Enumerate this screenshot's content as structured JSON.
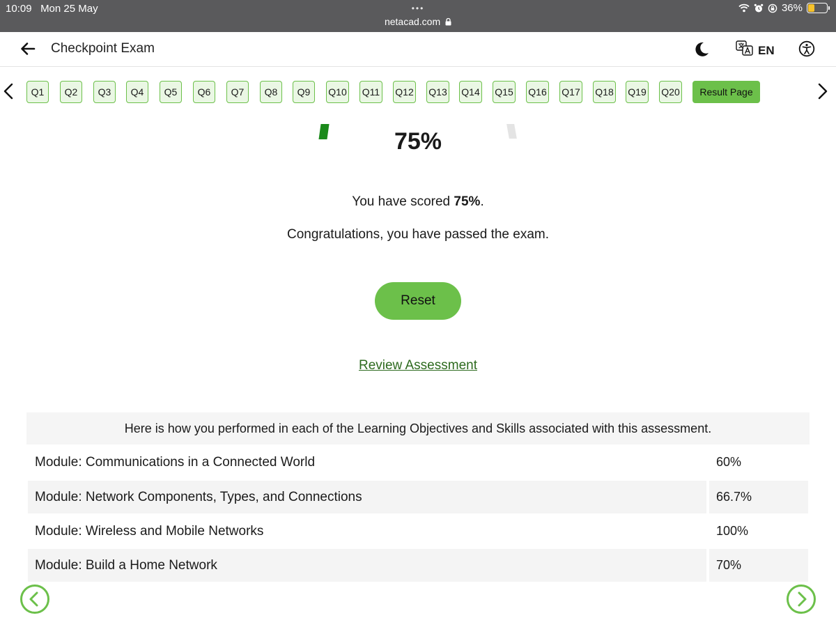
{
  "status": {
    "time": "10:09",
    "date": "Mon 25 May",
    "battery": "36%",
    "battery_level": 0.36,
    "url": "netacad.com",
    "dots": "•••"
  },
  "header": {
    "title": "Checkpoint Exam",
    "language": "EN"
  },
  "nav": {
    "questions": [
      "Q1",
      "Q2",
      "Q3",
      "Q4",
      "Q5",
      "Q6",
      "Q7",
      "Q8",
      "Q9",
      "Q10",
      "Q11",
      "Q12",
      "Q13",
      "Q14",
      "Q15",
      "Q16",
      "Q17",
      "Q18",
      "Q19",
      "Q20"
    ],
    "result_label": "Result Page"
  },
  "result": {
    "score": "75%",
    "score_value": 75,
    "scored_prefix": "You have scored ",
    "scored_value": "75%",
    "scored_suffix": ".",
    "message": "Congratulations, you have passed the exam.",
    "reset_label": "Reset",
    "review_label": "Review Assessment"
  },
  "objectives": {
    "heading": "Here is how you performed in each of the Learning Objectives and Skills associated with this assessment.",
    "rows": [
      {
        "module": "Module: Communications in a Connected World",
        "percent": "60%"
      },
      {
        "module": "Module: Network Components, Types, and Connections",
        "percent": "66.7%"
      },
      {
        "module": "Module: Wireless and Mobile Networks",
        "percent": "100%"
      },
      {
        "module": "Module: Build a Home Network",
        "percent": "70%"
      }
    ]
  },
  "colors": {
    "accent": "#6cc04a",
    "accent_light": "#eaf7e4",
    "gauge_fill": "#1b8a1b",
    "link": "#2d6a1e",
    "statusbar": "#5a5a5c"
  }
}
